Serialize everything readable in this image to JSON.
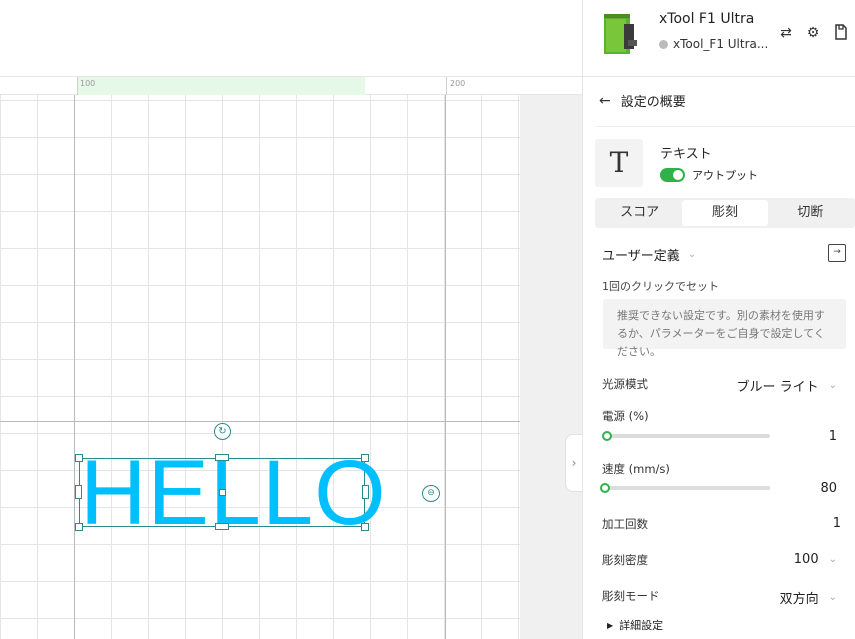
{
  "ruler": {
    "mark_100": "100",
    "mark_200": "200"
  },
  "canvas": {
    "object_text": "HELLO"
  },
  "device": {
    "name": "xTool F1 Ultra",
    "status": "xTool_F1 Ultra...",
    "icons": [
      "swap-icon",
      "settings-icon",
      "file-icon"
    ]
  },
  "panel": {
    "header": "設定の概要",
    "layer": {
      "title": "テキスト",
      "output_label": "アウトプット",
      "output_on": true
    },
    "tabs": [
      {
        "label": "スコア",
        "active": false
      },
      {
        "label": "彫刻",
        "active": true
      },
      {
        "label": "切断",
        "active": false
      }
    ],
    "preset": "ユーザー定義",
    "one_click_label": "1回のクリックでセット",
    "notice": "推奨できない設定です。別の素材を使用するか、パラメーターをご自身で設定してください。",
    "params": {
      "light_source": {
        "label": "光源模式",
        "value": "ブルー ライト"
      },
      "power": {
        "label": "電源 (%)",
        "value": "1",
        "fraction": 0.01
      },
      "speed": {
        "label": "速度 (mm/s)",
        "value": "80",
        "fraction": 0.0
      },
      "passes": {
        "label": "加工回数",
        "value": "1"
      },
      "density": {
        "label": "彫刻密度",
        "value": "100"
      },
      "mode": {
        "label": "彫刻モード",
        "value": "双方向"
      }
    },
    "advanced": "詳細設定"
  },
  "colors": {
    "accent": "#2fb24c",
    "object": "#00bfff",
    "selection": "#2d8a8a"
  }
}
